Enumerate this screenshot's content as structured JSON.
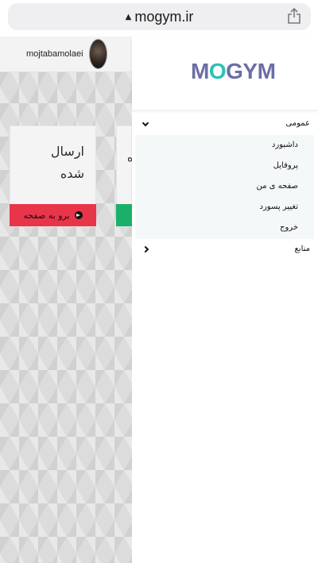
{
  "browser": {
    "url": "mogym.ir"
  },
  "header": {
    "username": "mojtabamolaei"
  },
  "cards": [
    {
      "title_line1": "ارسال",
      "title_line2": "شده",
      "button_label": "برو به صفحه",
      "button_color": "#e9354a"
    },
    {
      "partial_char": "ه",
      "button_color": "#1bb06a"
    }
  ],
  "drawer": {
    "logo_text_pre": "M",
    "logo_o": "O",
    "logo_text_post": "GYM",
    "sections": {
      "general": "عمومی",
      "resources": "منابع"
    },
    "items": [
      "داشبورد",
      "پروفایل",
      "صفحه ی من",
      "تغییر پسورد",
      "خروج"
    ]
  },
  "colors": {
    "brand": "#6b6ea6",
    "accent": "#2cc1b6"
  }
}
